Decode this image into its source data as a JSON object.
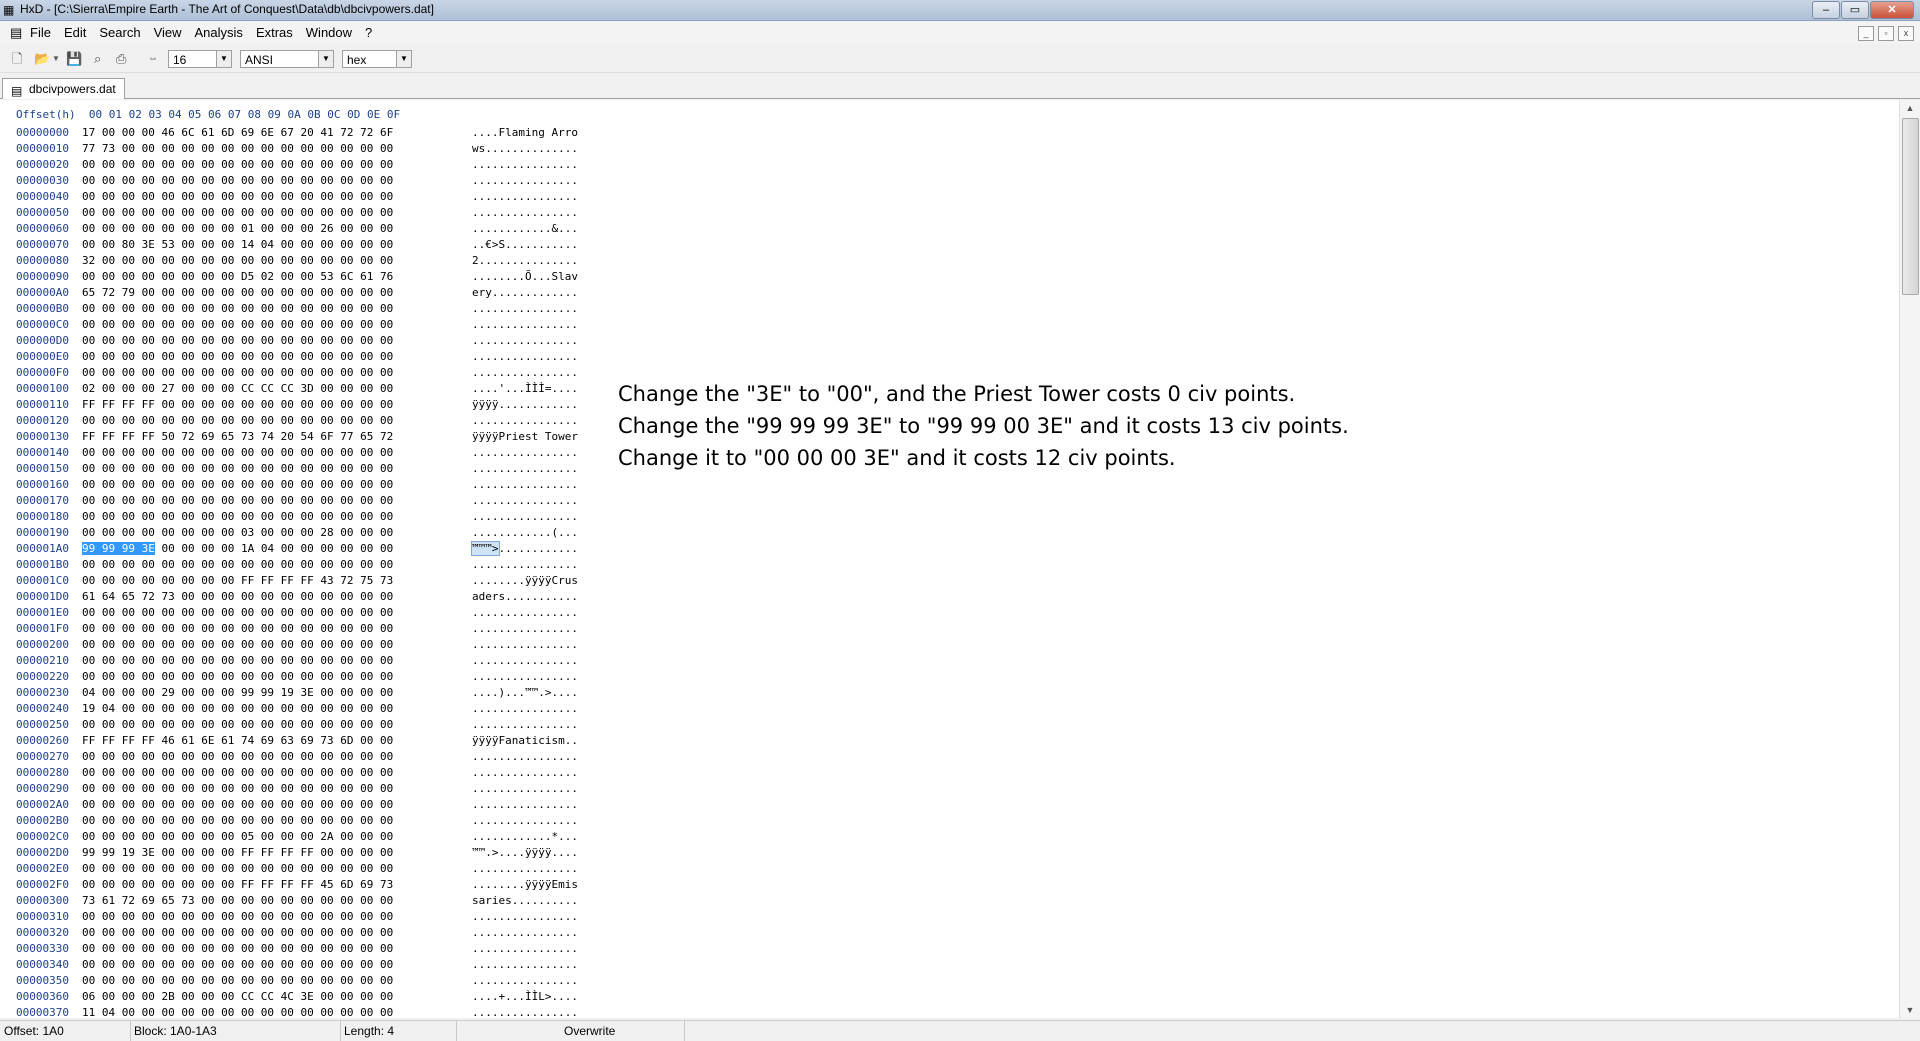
{
  "window": {
    "title": "HxD - [C:\\Sierra\\Empire Earth - The Art of Conquest\\Data\\db\\dbcivpowers.dat]",
    "buttons": [
      "–",
      "▭",
      "✕"
    ]
  },
  "menu": {
    "items": [
      "File",
      "Edit",
      "Search",
      "View",
      "Analysis",
      "Extras",
      "Window",
      "?"
    ]
  },
  "toolbar": {
    "bytes_per_row": "16",
    "charset": "ANSI",
    "offset_base": "hex"
  },
  "tab": {
    "label": "dbcivpowers.dat"
  },
  "hex_header": "Offset(h)  00 01 02 03 04 05 06 07 08 09 0A 0B 0C 0D 0E 0F",
  "rows": [
    {
      "off": "00000000",
      "hex": "17 00 00 00 46 6C 61 6D 69 6E 67 20 41 72 72 6F",
      "asc": "....Flaming Arro"
    },
    {
      "off": "00000010",
      "hex": "77 73 00 00 00 00 00 00 00 00 00 00 00 00 00 00",
      "asc": "ws.............."
    },
    {
      "off": "00000020",
      "hex": "00 00 00 00 00 00 00 00 00 00 00 00 00 00 00 00",
      "asc": "................"
    },
    {
      "off": "00000030",
      "hex": "00 00 00 00 00 00 00 00 00 00 00 00 00 00 00 00",
      "asc": "................"
    },
    {
      "off": "00000040",
      "hex": "00 00 00 00 00 00 00 00 00 00 00 00 00 00 00 00",
      "asc": "................"
    },
    {
      "off": "00000050",
      "hex": "00 00 00 00 00 00 00 00 00 00 00 00 00 00 00 00",
      "asc": "................"
    },
    {
      "off": "00000060",
      "hex": "00 00 00 00 00 00 00 00 01 00 00 00 26 00 00 00",
      "asc": "............&..."
    },
    {
      "off": "00000070",
      "hex": "00 00 80 3E 53 00 00 00 14 04 00 00 00 00 00 00",
      "asc": "..€>S..........."
    },
    {
      "off": "00000080",
      "hex": "32 00 00 00 00 00 00 00 00 00 00 00 00 00 00 00",
      "asc": "2..............."
    },
    {
      "off": "00000090",
      "hex": "00 00 00 00 00 00 00 00 D5 02 00 00 53 6C 61 76",
      "asc": "........Õ...Slav"
    },
    {
      "off": "000000A0",
      "hex": "65 72 79 00 00 00 00 00 00 00 00 00 00 00 00 00",
      "asc": "ery............."
    },
    {
      "off": "000000B0",
      "hex": "00 00 00 00 00 00 00 00 00 00 00 00 00 00 00 00",
      "asc": "................"
    },
    {
      "off": "000000C0",
      "hex": "00 00 00 00 00 00 00 00 00 00 00 00 00 00 00 00",
      "asc": "................"
    },
    {
      "off": "000000D0",
      "hex": "00 00 00 00 00 00 00 00 00 00 00 00 00 00 00 00",
      "asc": "................"
    },
    {
      "off": "000000E0",
      "hex": "00 00 00 00 00 00 00 00 00 00 00 00 00 00 00 00",
      "asc": "................"
    },
    {
      "off": "000000F0",
      "hex": "00 00 00 00 00 00 00 00 00 00 00 00 00 00 00 00",
      "asc": "................"
    },
    {
      "off": "00000100",
      "hex": "02 00 00 00 27 00 00 00 CC CC CC 3D 00 00 00 00",
      "asc": "....'...ÌÌÌ=...."
    },
    {
      "off": "00000110",
      "hex": "FF FF FF FF 00 00 00 00 00 00 00 00 00 00 00 00",
      "asc": "ÿÿÿÿ............"
    },
    {
      "off": "00000120",
      "hex": "00 00 00 00 00 00 00 00 00 00 00 00 00 00 00 00",
      "asc": "................"
    },
    {
      "off": "00000130",
      "hex": "FF FF FF FF 50 72 69 65 73 74 20 54 6F 77 65 72",
      "asc": "ÿÿÿÿPriest Tower"
    },
    {
      "off": "00000140",
      "hex": "00 00 00 00 00 00 00 00 00 00 00 00 00 00 00 00",
      "asc": "................"
    },
    {
      "off": "00000150",
      "hex": "00 00 00 00 00 00 00 00 00 00 00 00 00 00 00 00",
      "asc": "................"
    },
    {
      "off": "00000160",
      "hex": "00 00 00 00 00 00 00 00 00 00 00 00 00 00 00 00",
      "asc": "................"
    },
    {
      "off": "00000170",
      "hex": "00 00 00 00 00 00 00 00 00 00 00 00 00 00 00 00",
      "asc": "................"
    },
    {
      "off": "00000180",
      "hex": "00 00 00 00 00 00 00 00 00 00 00 00 00 00 00 00",
      "asc": "................"
    },
    {
      "off": "00000190",
      "hex": "00 00 00 00 00 00 00 00 03 00 00 00 28 00 00 00",
      "asc": "............(..."
    },
    {
      "off": "000001A0",
      "hex": "99 99 99 3E 00 00 00 00 1A 04 00 00 00 00 00 00",
      "asc": "™™™>............",
      "sel_hex": "99 99 99 3E",
      "rest_hex": " 00 00 00 00 1A 04 00 00 00 00 00 00",
      "sel_asc": "™™™>",
      "rest_asc": "............"
    },
    {
      "off": "000001B0",
      "hex": "00 00 00 00 00 00 00 00 00 00 00 00 00 00 00 00",
      "asc": "................"
    },
    {
      "off": "000001C0",
      "hex": "00 00 00 00 00 00 00 00 FF FF FF FF 43 72 75 73",
      "asc": "........ÿÿÿÿCrus"
    },
    {
      "off": "000001D0",
      "hex": "61 64 65 72 73 00 00 00 00 00 00 00 00 00 00 00",
      "asc": "aders..........."
    },
    {
      "off": "000001E0",
      "hex": "00 00 00 00 00 00 00 00 00 00 00 00 00 00 00 00",
      "asc": "................"
    },
    {
      "off": "000001F0",
      "hex": "00 00 00 00 00 00 00 00 00 00 00 00 00 00 00 00",
      "asc": "................"
    },
    {
      "off": "00000200",
      "hex": "00 00 00 00 00 00 00 00 00 00 00 00 00 00 00 00",
      "asc": "................"
    },
    {
      "off": "00000210",
      "hex": "00 00 00 00 00 00 00 00 00 00 00 00 00 00 00 00",
      "asc": "................"
    },
    {
      "off": "00000220",
      "hex": "00 00 00 00 00 00 00 00 00 00 00 00 00 00 00 00",
      "asc": "................"
    },
    {
      "off": "00000230",
      "hex": "04 00 00 00 29 00 00 00 99 99 19 3E 00 00 00 00",
      "asc": "....)...™™.>...."
    },
    {
      "off": "00000240",
      "hex": "19 04 00 00 00 00 00 00 00 00 00 00 00 00 00 00",
      "asc": "................"
    },
    {
      "off": "00000250",
      "hex": "00 00 00 00 00 00 00 00 00 00 00 00 00 00 00 00",
      "asc": "................"
    },
    {
      "off": "00000260",
      "hex": "FF FF FF FF 46 61 6E 61 74 69 63 69 73 6D 00 00",
      "asc": "ÿÿÿÿFanaticism.."
    },
    {
      "off": "00000270",
      "hex": "00 00 00 00 00 00 00 00 00 00 00 00 00 00 00 00",
      "asc": "................"
    },
    {
      "off": "00000280",
      "hex": "00 00 00 00 00 00 00 00 00 00 00 00 00 00 00 00",
      "asc": "................"
    },
    {
      "off": "00000290",
      "hex": "00 00 00 00 00 00 00 00 00 00 00 00 00 00 00 00",
      "asc": "................"
    },
    {
      "off": "000002A0",
      "hex": "00 00 00 00 00 00 00 00 00 00 00 00 00 00 00 00",
      "asc": "................"
    },
    {
      "off": "000002B0",
      "hex": "00 00 00 00 00 00 00 00 00 00 00 00 00 00 00 00",
      "asc": "................"
    },
    {
      "off": "000002C0",
      "hex": "00 00 00 00 00 00 00 00 05 00 00 00 2A 00 00 00",
      "asc": "............*..."
    },
    {
      "off": "000002D0",
      "hex": "99 99 19 3E 00 00 00 00 FF FF FF FF 00 00 00 00",
      "asc": "™™.>....ÿÿÿÿ...."
    },
    {
      "off": "000002E0",
      "hex": "00 00 00 00 00 00 00 00 00 00 00 00 00 00 00 00",
      "asc": "................"
    },
    {
      "off": "000002F0",
      "hex": "00 00 00 00 00 00 00 00 FF FF FF FF 45 6D 69 73",
      "asc": "........ÿÿÿÿEmis"
    },
    {
      "off": "00000300",
      "hex": "73 61 72 69 65 73 00 00 00 00 00 00 00 00 00 00",
      "asc": "saries.........."
    },
    {
      "off": "00000310",
      "hex": "00 00 00 00 00 00 00 00 00 00 00 00 00 00 00 00",
      "asc": "................"
    },
    {
      "off": "00000320",
      "hex": "00 00 00 00 00 00 00 00 00 00 00 00 00 00 00 00",
      "asc": "................"
    },
    {
      "off": "00000330",
      "hex": "00 00 00 00 00 00 00 00 00 00 00 00 00 00 00 00",
      "asc": "................"
    },
    {
      "off": "00000340",
      "hex": "00 00 00 00 00 00 00 00 00 00 00 00 00 00 00 00",
      "asc": "................"
    },
    {
      "off": "00000350",
      "hex": "00 00 00 00 00 00 00 00 00 00 00 00 00 00 00 00",
      "asc": "................"
    },
    {
      "off": "00000360",
      "hex": "06 00 00 00 2B 00 00 00 CC CC 4C 3E 00 00 00 00",
      "asc": "....+...ÌÌL>...."
    },
    {
      "off": "00000370",
      "hex": "11 04 00 00 00 00 00 00 00 00 00 00 00 00 00 00",
      "asc": "................"
    }
  ],
  "annotations": [
    "Change the \"3E\" to \"00\", and the Priest Tower costs 0 civ points.",
    "Change the \"99 99 99 3E\" to \"99 99 00 3E\" and it costs 13 civ points.",
    "Change it to \"00 00 00 3E\" and it costs 12 civ points."
  ],
  "status": {
    "offset": "Offset: 1A0",
    "block": "Block: 1A0-1A3",
    "length": "Length: 4",
    "mode": "Overwrite"
  },
  "colors": {
    "selection": "#3399ff",
    "offset_text": "#1d3f8a"
  }
}
